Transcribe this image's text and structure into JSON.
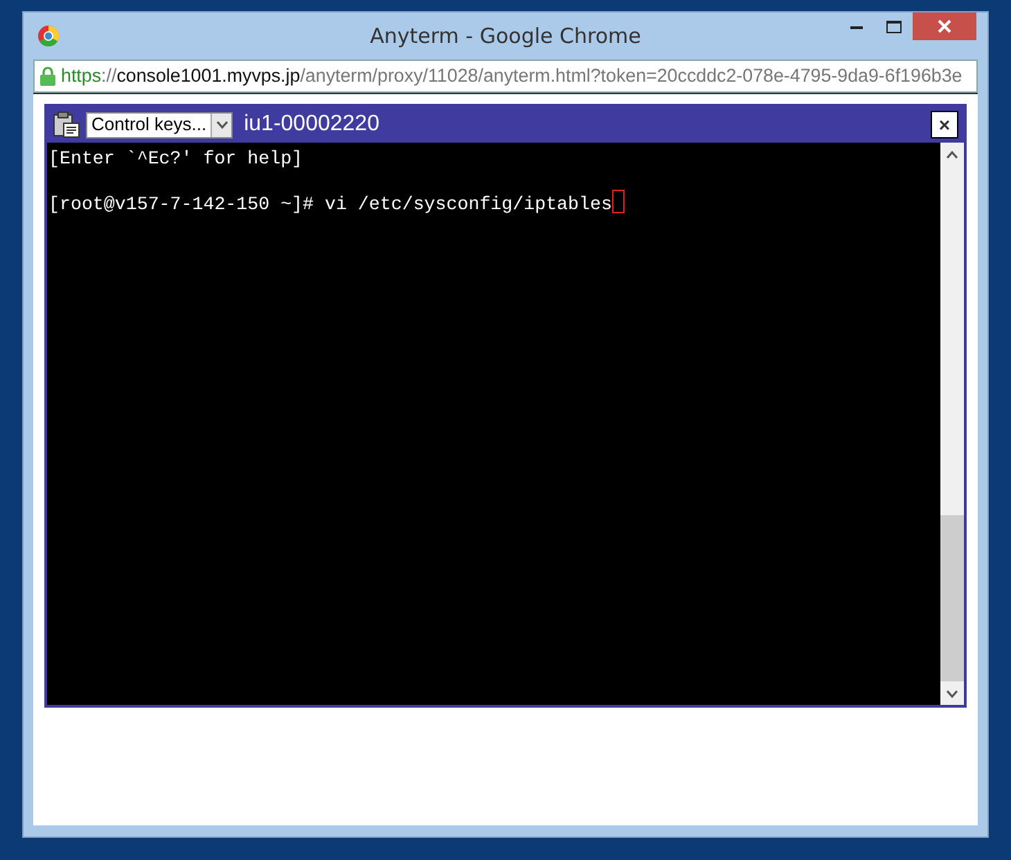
{
  "window": {
    "title": "Anyterm - Google Chrome"
  },
  "address_bar": {
    "secure": true,
    "scheme": "https",
    "separator": "://",
    "host": "console1001.myvps.jp",
    "path": "/anyterm/proxy/11028/anyterm.html?token=20ccddc2-078e-4795-9da9-6f196b3e"
  },
  "terminal": {
    "control_keys": {
      "value": "Control keys..."
    },
    "title": "iu1-00002220",
    "close": "×",
    "lines": [
      {
        "text": "[Enter `^Ec?' for help]",
        "cursor": false
      },
      {
        "text": "[root@v157-7-142-150 ~]# vi /etc/sysconfig/iptables",
        "cursor": true
      }
    ]
  }
}
